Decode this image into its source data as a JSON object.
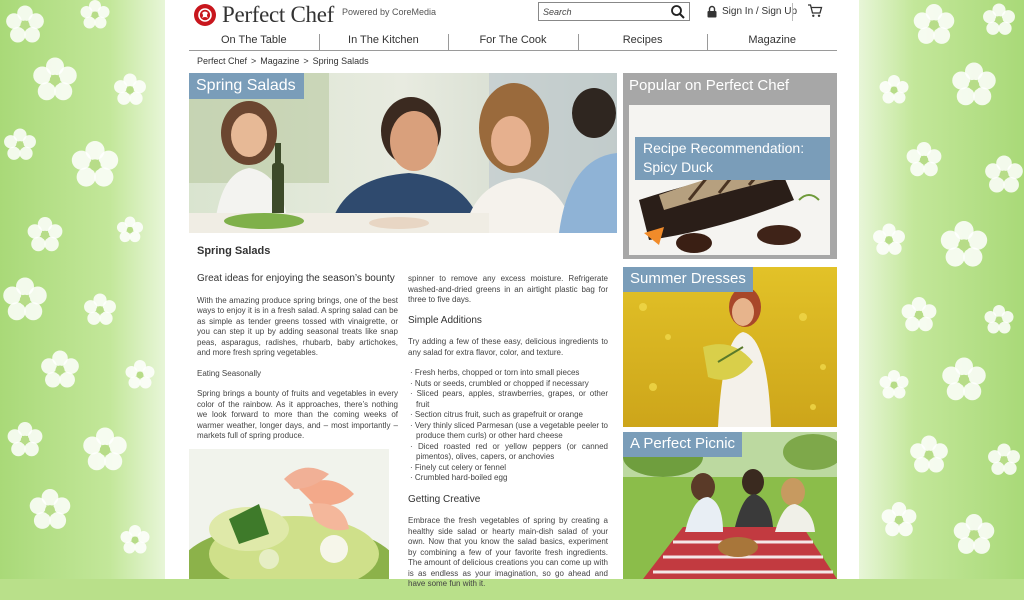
{
  "brand": {
    "name": "Perfect Chef",
    "powered_by": "Powered by CoreMedia",
    "accent_color": "#7a9db9",
    "logo_color": "#c8161d"
  },
  "header": {
    "search_placeholder": "Search",
    "signin_label": "Sign In / Sign Up",
    "icons": [
      "search-icon",
      "lock-icon",
      "cart-icon"
    ]
  },
  "nav": {
    "items": [
      {
        "label": "On The Table"
      },
      {
        "label": "In The Kitchen"
      },
      {
        "label": "For The Cook"
      },
      {
        "label": "Recipes"
      },
      {
        "label": "Magazine"
      }
    ]
  },
  "breadcrumb": {
    "items": [
      "Perfect Chef",
      "Magazine",
      "Spring Salads"
    ],
    "separator": ">"
  },
  "hero": {
    "label": "Spring Salads"
  },
  "article": {
    "title": "Spring Salads",
    "subtitle": "Great ideas for enjoying the season’s bounty",
    "intro": "With the amazing produce spring brings, one of the best ways to enjoy it is in a fresh salad. A spring salad can be as simple as tender greens tossed with vinaigrette, or you can step it up by adding seasonal treats like snap peas, asparagus, radishes, rhubarb, baby artichokes, and more fresh spring vegetables.",
    "eating_label": "Eating Seasonally",
    "eating_text": "Spring brings a bounty of fruits and vegetables in every color of the rainbow. As it approaches, there’s nothing we look forward to more than the coming weeks of warmer weather, longer days, and – most importantly – markets full of spring produce.",
    "spinner_text": "spinner to remove any excess moisture. Refrigerate washed-and-dried greens in an airtight plastic bag for three to five days.",
    "additions_heading": "Simple Additions",
    "additions_intro": "Try adding a few of these easy, delicious ingredients to any salad for extra flavor, color, and texture.",
    "additions": [
      "· Fresh herbs, chopped or torn into small pieces",
      "· Nuts or seeds, crumbled or chopped if necessary",
      "· Sliced pears, apples, strawberries, grapes, or other fruit",
      "· Section citrus fruit, such as grapefruit or orange",
      "· Very thinly sliced Parmesan (use a vegetable peeler to produce them curls) or other hard cheese",
      "· Diced roasted red or yellow peppers (or canned pimentos), olives, capers, or anchovies",
      "· Finely cut celery or fennel",
      "· Crumbled hard-boiled egg"
    ],
    "creative_heading": "Getting Creative",
    "creative_text": "Embrace the fresh vegetables of spring by creating a healthy side salad or hearty main-dish salad of your own. Now that you know the salad basics, experiment by combining a few of your favorite fresh ingredients. The amount of delicious creations you can come up with is as endless as your imagination, so go ahead and have some fun with it."
  },
  "sidebar": {
    "popular_title": "Popular on Perfect Chef",
    "recommendation": "Recipe Recommendation: Spicy Duck",
    "cards": [
      {
        "label": "Summer Dresses"
      },
      {
        "label": "A Perfect Picnic"
      }
    ]
  }
}
